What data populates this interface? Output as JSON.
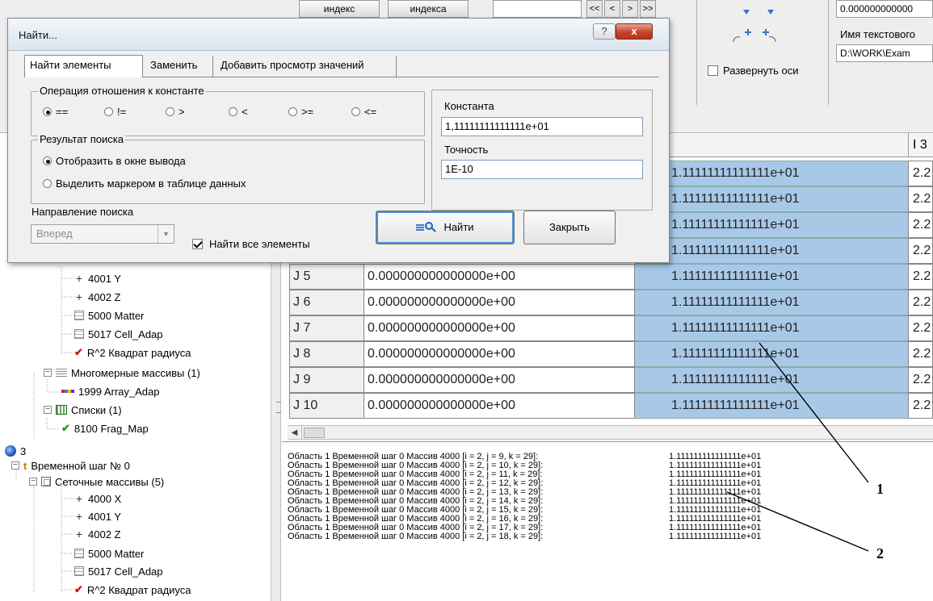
{
  "toolbar": {
    "btn_index_1": "индекс",
    "btn_index_2": "индекса",
    "expand_axes": "Развернуть оси",
    "value_box": "0.000000000000",
    "text_file_label": "Имя текстового",
    "text_file_path": "D:\\WORK\\Exam",
    "nav": [
      "<<",
      "<",
      ">",
      ">>"
    ]
  },
  "dialog": {
    "title": "Найти...",
    "tabs": [
      "Найти элементы",
      "Заменить",
      "Добавить просмотр значений"
    ],
    "op_group": {
      "label": "Операция отношения к константе",
      "options": [
        "==",
        "!=",
        ">",
        "<",
        ">=",
        "<="
      ],
      "selected_index": 0
    },
    "result_group": {
      "label": "Результат поиска",
      "options": [
        "Отобразить в окне вывода",
        "Выделить маркером в таблице данных"
      ],
      "selected_index": 0
    },
    "constant_label": "Константа",
    "constant_value": "1,11111111111111e+01",
    "precision_label": "Точность",
    "precision_value": "1E-10",
    "direction_label": "Направление поиска",
    "direction_value": "Вперед",
    "find_all_label": "Найти все элементы",
    "find_all_checked": true,
    "find_button": "Найти",
    "close_button": "Закрыть",
    "help_glyph": "?",
    "close_glyph": "x"
  },
  "tree": {
    "items": [
      "4001 Y",
      "4002 Z",
      "5000 Matter",
      "5017 Cell_Adap",
      "R^2 Квадрат радиуса",
      "Многомерные массивы (1)",
      "1999 Array_Adap",
      "Списки (1)",
      "8100 Frag_Map",
      "3",
      "Временной шаг № 0",
      "Сеточные массивы (5)",
      "4000 X",
      "4001 Y",
      "4002 Z",
      "5000 Matter",
      "5017 Cell_Adap",
      "R^2 Квадрат радиуса"
    ]
  },
  "grid": {
    "header_col3": "I 3",
    "rows": [
      {
        "j": "",
        "v1": "",
        "v2": "1.11111111111111e+01",
        "v3": "2.2"
      },
      {
        "j": "",
        "v1": "",
        "v2": "1.11111111111111e+01",
        "v3": "2.2"
      },
      {
        "j": "",
        "v1": "",
        "v2": "1.11111111111111e+01",
        "v3": "2.2"
      },
      {
        "j": "",
        "v1": "",
        "v2": "1.11111111111111e+01",
        "v3": "2.2"
      },
      {
        "j": "J 5",
        "v1": "0.000000000000000e+00",
        "v2": "1.11111111111111e+01",
        "v3": "2.2"
      },
      {
        "j": "J 6",
        "v1": "0.000000000000000e+00",
        "v2": "1.11111111111111e+01",
        "v3": "2.2"
      },
      {
        "j": "J 7",
        "v1": "0.000000000000000e+00",
        "v2": "1.11111111111111e+01",
        "v3": "2.2"
      },
      {
        "j": "J 8",
        "v1": "0.000000000000000e+00",
        "v2": "1.11111111111111e+01",
        "v3": "2.2"
      },
      {
        "j": "J 9",
        "v1": "0.000000000000000e+00",
        "v2": "1.11111111111111e+01",
        "v3": "2.2"
      },
      {
        "j": "J 10",
        "v1": "0.000000000000000e+00",
        "v2": "1.11111111111111e+01",
        "v3": "2.2"
      }
    ]
  },
  "output": {
    "lines": [
      {
        "text": "Область 1  Временной шаг 0  Массив 4000 [i = 2, j = 9, k = 29]:",
        "value": "1.111111111111111e+01"
      },
      {
        "text": "Область 1  Временной шаг 0  Массив 4000 [i = 2, j = 10, k = 29]:",
        "value": "1.111111111111111e+01"
      },
      {
        "text": "Область 1  Временной шаг 0  Массив 4000 [i = 2, j = 11, k = 29]:",
        "value": "1.111111111111111e+01"
      },
      {
        "text": "Область 1  Временной шаг 0  Массив 4000 [i = 2, j = 12, k = 29]:",
        "value": "1.111111111111111e+01"
      },
      {
        "text": "Область 1  Временной шаг 0  Массив 4000 [i = 2, j = 13, k = 29]:",
        "value": "1.111111111111111e+01"
      },
      {
        "text": "Область 1  Временной шаг 0  Массив 4000 [i = 2, j = 14, k = 29]:",
        "value": "1.111111111111111e+01"
      },
      {
        "text": "Область 1  Временной шаг 0  Массив 4000 [i = 2, j = 15, k = 29]:",
        "value": "1.111111111111111e+01"
      },
      {
        "text": "Область 1  Временной шаг 0  Массив 4000 [i = 2, j = 16, k = 29]:",
        "value": "1.111111111111111e+01"
      },
      {
        "text": "Область 1  Временной шаг 0  Массив 4000 [i = 2, j = 17, k = 29]:",
        "value": "1.111111111111111e+01"
      },
      {
        "text": "Область 1  Временной шаг 0  Массив 4000 [i = 2, j = 18, k = 29]:",
        "value": "1.111111111111111e+01"
      }
    ]
  },
  "callouts": [
    "1",
    "2"
  ]
}
